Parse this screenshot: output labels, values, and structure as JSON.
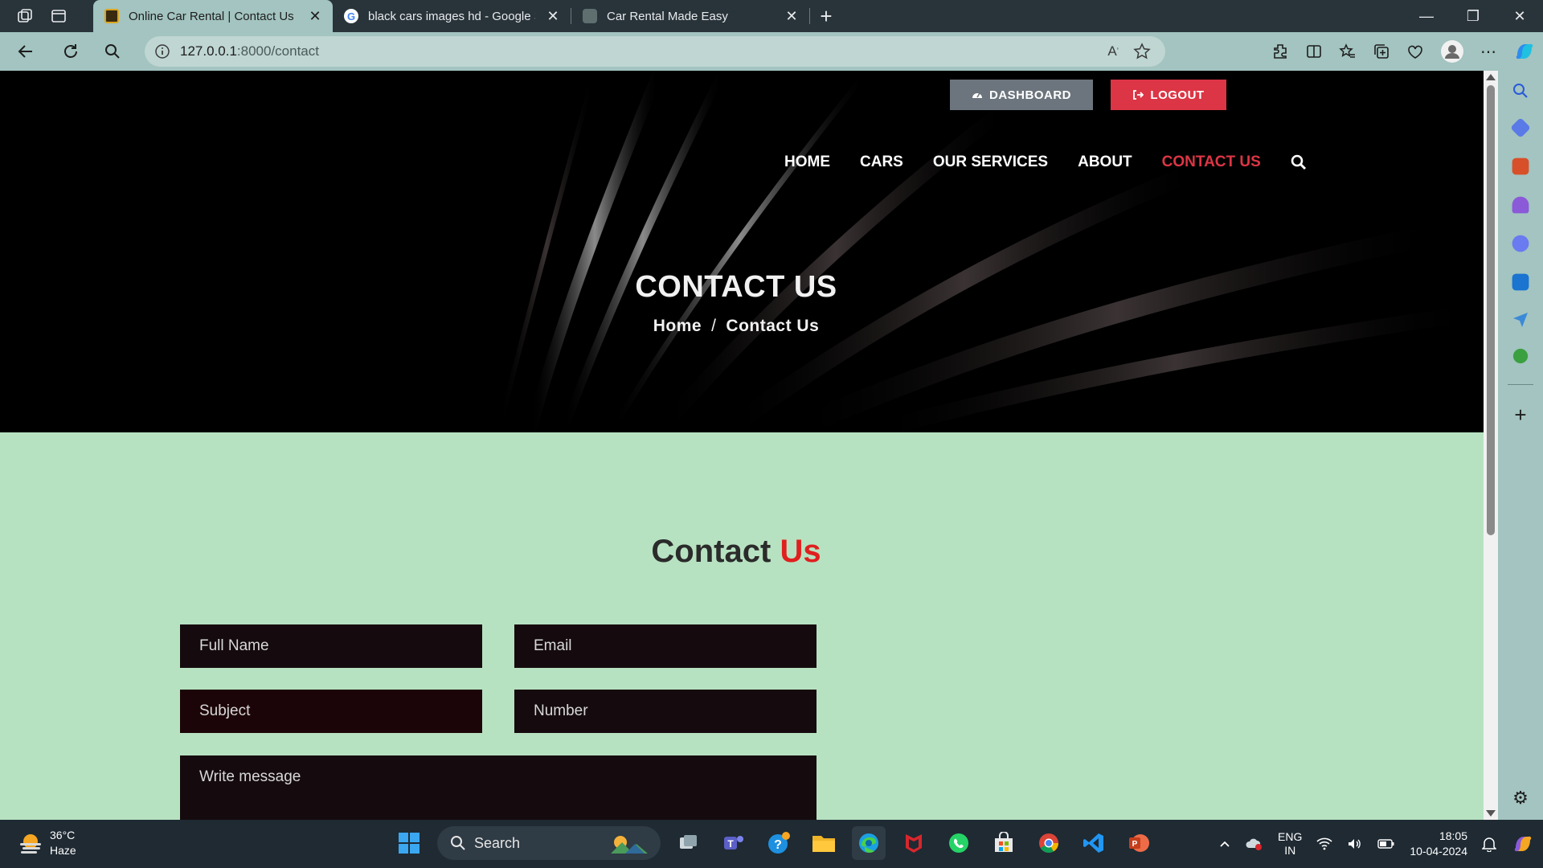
{
  "browser": {
    "tabs": [
      {
        "title": "Online Car Rental | Contact Us",
        "active": true
      },
      {
        "title": "black cars images hd - Google Se",
        "active": false
      },
      {
        "title": "Car Rental Made Easy",
        "active": false
      }
    ],
    "url_host": "127.0.0.1",
    "url_rest": ":8000/contact"
  },
  "header": {
    "dashboard_label": "DASHBOARD",
    "logout_label": "LOGOUT"
  },
  "nav": {
    "items": [
      "HOME",
      "CARS",
      "OUR SERVICES",
      "ABOUT",
      "CONTACT US"
    ]
  },
  "hero": {
    "title": "CONTACT US",
    "breadcrumb_home": "Home",
    "breadcrumb_sep": "/",
    "breadcrumb_current": "Contact Us"
  },
  "contact": {
    "title_main": "Contact",
    "title_accent": "Us",
    "placeholders": {
      "full_name": "Full Name",
      "email": "Email",
      "subject": "Subject",
      "number": "Number",
      "message": "Write message"
    }
  },
  "taskbar": {
    "temperature": "36°C",
    "condition": "Haze",
    "search_label": "Search",
    "lang_line1": "ENG",
    "lang_line2": "IN",
    "time": "18:05",
    "date": "10-04-2024"
  },
  "colors": {
    "accent_red": "#dc3545",
    "section_bg": "#b7e2c1",
    "browser_chrome": "#a3c4c0"
  }
}
